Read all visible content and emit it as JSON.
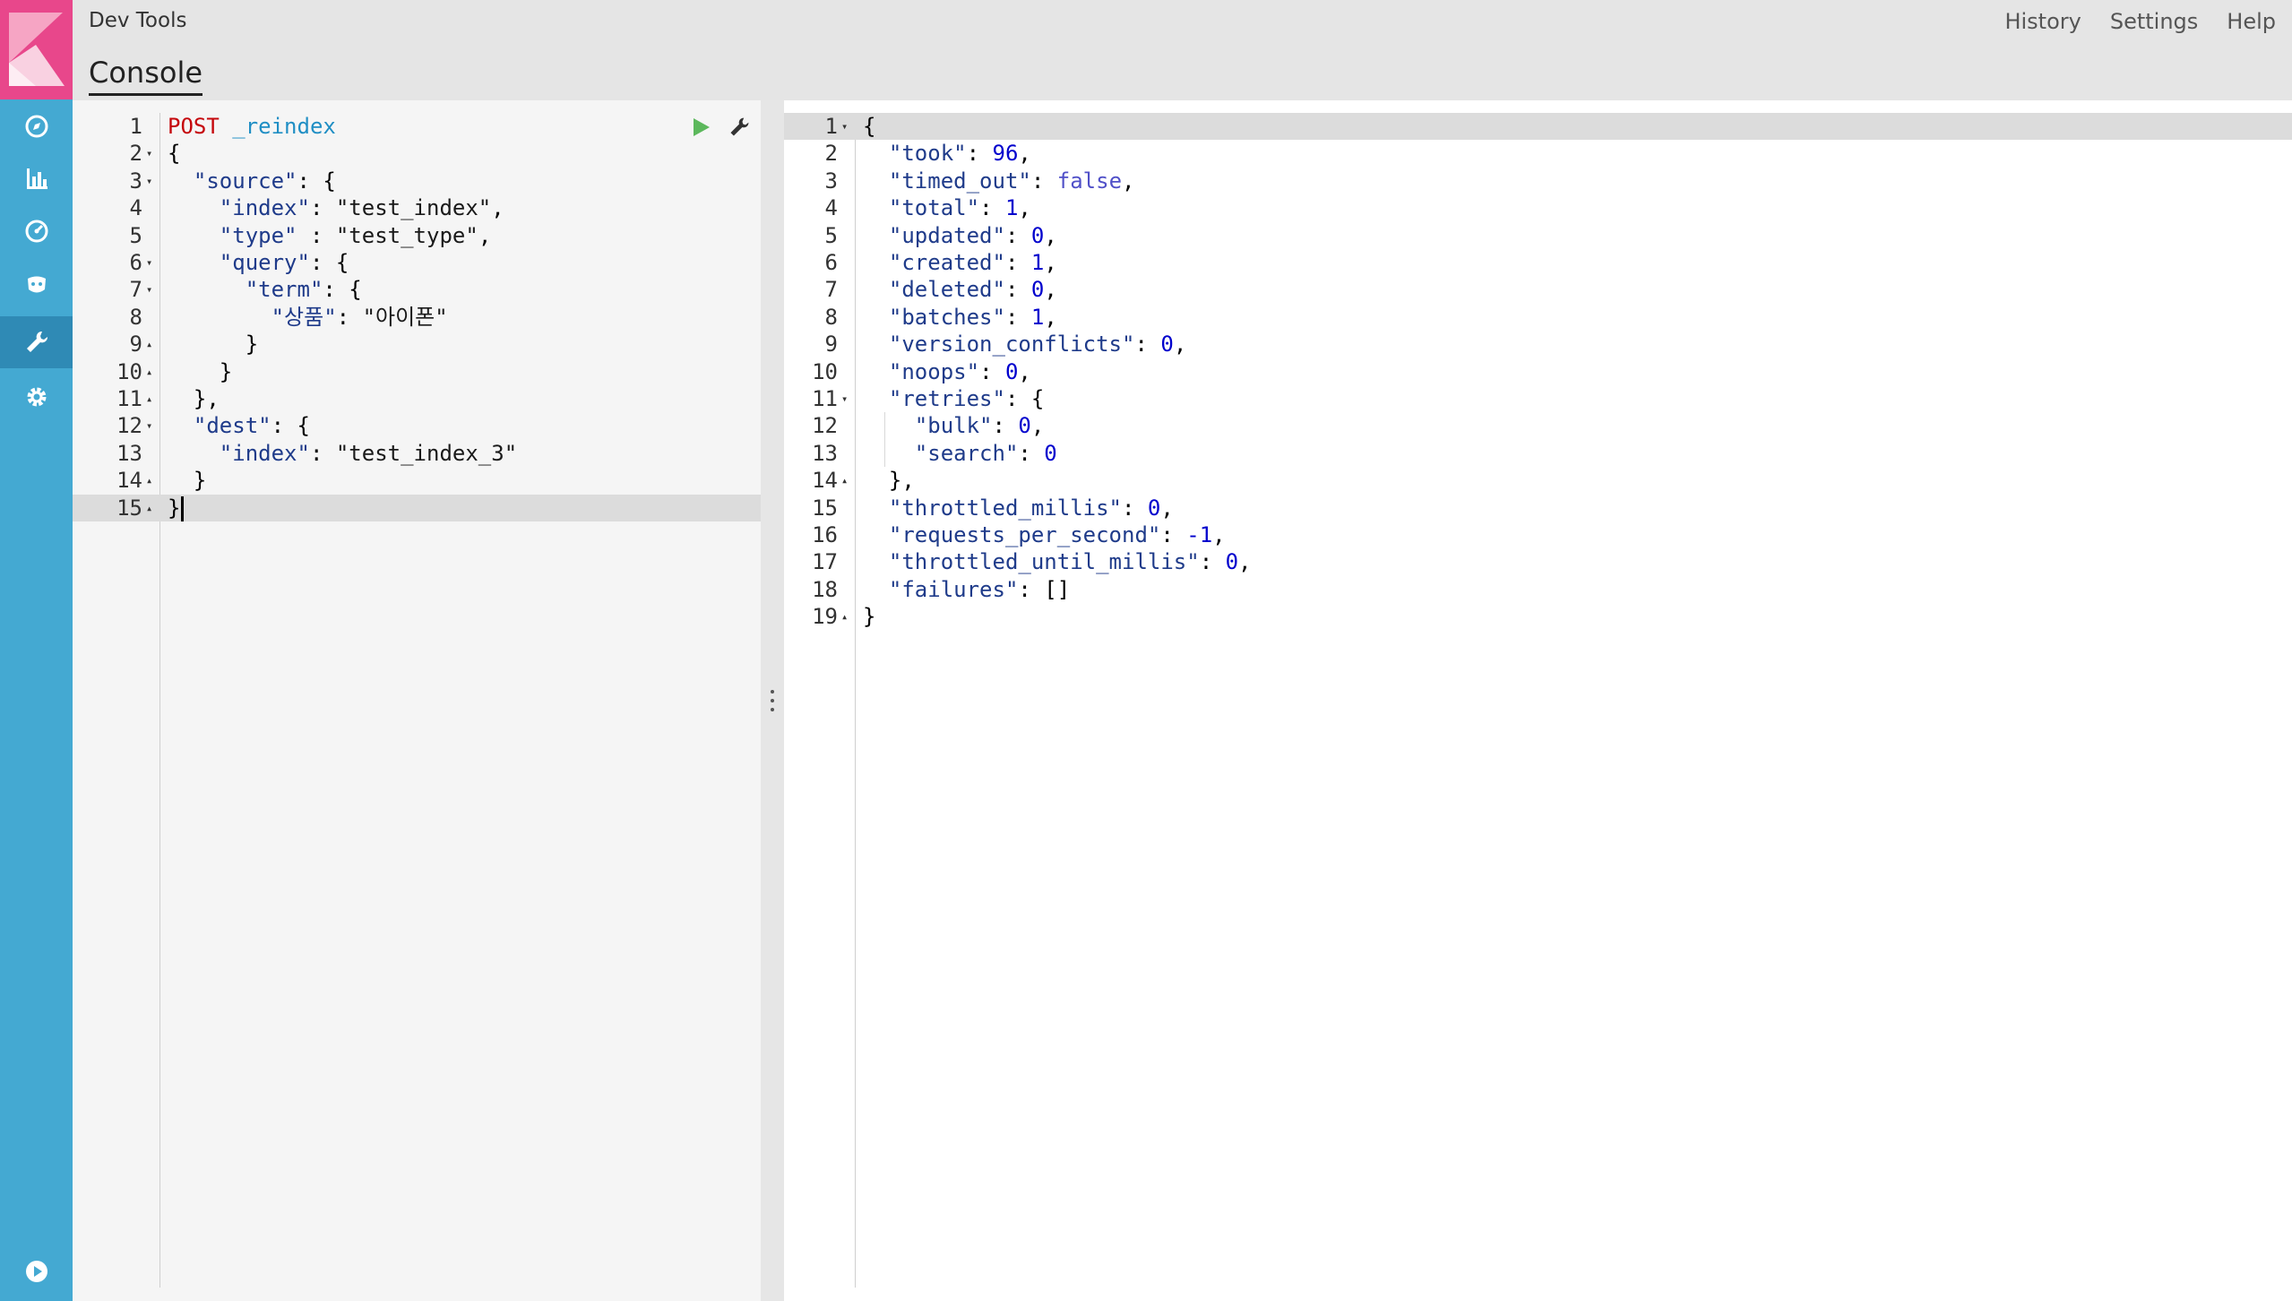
{
  "app": {
    "title": "Dev Tools",
    "tab": "Console"
  },
  "top_links": [
    "History",
    "Settings",
    "Help"
  ],
  "colors": {
    "sidebar": "#44a9d2",
    "logo": "#e8478b",
    "topbar": "#e5e5e5",
    "method": "#c5060b",
    "url": "#1f8ec4",
    "number": "#0000cd",
    "bool": "#5050c8",
    "run": "#5cb85c"
  },
  "sidebar": {
    "items": [
      {
        "name": "discover-icon"
      },
      {
        "name": "visualize-icon"
      },
      {
        "name": "dashboard-icon"
      },
      {
        "name": "timelion-icon"
      },
      {
        "name": "devtools-icon",
        "active": true
      },
      {
        "name": "management-icon"
      }
    ],
    "bottom": "collapse-icon"
  },
  "request": {
    "active_line": 15,
    "lines": [
      {
        "n": "1",
        "fold": "",
        "tokens": [
          [
            "method",
            "POST"
          ],
          [
            "punc",
            " "
          ],
          [
            "url",
            "_reindex"
          ]
        ]
      },
      {
        "n": "2",
        "fold": "▾",
        "tokens": [
          [
            "punc",
            "{"
          ]
        ]
      },
      {
        "n": "3",
        "fold": "▾",
        "tokens": [
          [
            "punc",
            "  "
          ],
          [
            "key",
            "\"source\""
          ],
          [
            "punc",
            ": {"
          ]
        ]
      },
      {
        "n": "4",
        "fold": "",
        "tokens": [
          [
            "punc",
            "    "
          ],
          [
            "key",
            "\"index\""
          ],
          [
            "punc",
            ": "
          ],
          [
            "str",
            "\"test_index\""
          ],
          [
            "punc",
            ","
          ]
        ]
      },
      {
        "n": "5",
        "fold": "",
        "tokens": [
          [
            "punc",
            "    "
          ],
          [
            "key",
            "\"type\""
          ],
          [
            "punc",
            " : "
          ],
          [
            "str",
            "\"test_type\""
          ],
          [
            "punc",
            ","
          ]
        ]
      },
      {
        "n": "6",
        "fold": "▾",
        "tokens": [
          [
            "punc",
            "    "
          ],
          [
            "key",
            "\"query\""
          ],
          [
            "punc",
            ": {"
          ]
        ]
      },
      {
        "n": "7",
        "fold": "▾",
        "tokens": [
          [
            "punc",
            "      "
          ],
          [
            "key",
            "\"term\""
          ],
          [
            "punc",
            ": {"
          ]
        ]
      },
      {
        "n": "8",
        "fold": "",
        "tokens": [
          [
            "punc",
            "        "
          ],
          [
            "key",
            "\"상품\""
          ],
          [
            "punc",
            ": "
          ],
          [
            "str",
            "\"아이폰\""
          ]
        ]
      },
      {
        "n": "9",
        "fold": "▴",
        "tokens": [
          [
            "punc",
            "      }"
          ]
        ]
      },
      {
        "n": "10",
        "fold": "▴",
        "tokens": [
          [
            "punc",
            "    }"
          ]
        ]
      },
      {
        "n": "11",
        "fold": "▴",
        "tokens": [
          [
            "punc",
            "  },"
          ]
        ]
      },
      {
        "n": "12",
        "fold": "▾",
        "tokens": [
          [
            "punc",
            "  "
          ],
          [
            "key",
            "\"dest\""
          ],
          [
            "punc",
            ": {"
          ]
        ]
      },
      {
        "n": "13",
        "fold": "",
        "tokens": [
          [
            "punc",
            "    "
          ],
          [
            "key",
            "\"index\""
          ],
          [
            "punc",
            ": "
          ],
          [
            "str",
            "\"test_index_3\""
          ]
        ]
      },
      {
        "n": "14",
        "fold": "▴",
        "tokens": [
          [
            "punc",
            "  }"
          ]
        ]
      },
      {
        "n": "15",
        "fold": "▴",
        "tokens": [
          [
            "punc",
            "}"
          ]
        ]
      }
    ]
  },
  "response": {
    "active_line": 1,
    "lines": [
      {
        "n": "1",
        "fold": "▾",
        "tokens": [
          [
            "punc",
            "{"
          ]
        ]
      },
      {
        "n": "2",
        "fold": "",
        "tokens": [
          [
            "punc",
            "  "
          ],
          [
            "key",
            "\"took\""
          ],
          [
            "punc",
            ": "
          ],
          [
            "num",
            "96"
          ],
          [
            "punc",
            ","
          ]
        ]
      },
      {
        "n": "3",
        "fold": "",
        "tokens": [
          [
            "punc",
            "  "
          ],
          [
            "key",
            "\"timed_out\""
          ],
          [
            "punc",
            ": "
          ],
          [
            "bool",
            "false"
          ],
          [
            "punc",
            ","
          ]
        ]
      },
      {
        "n": "4",
        "fold": "",
        "tokens": [
          [
            "punc",
            "  "
          ],
          [
            "key",
            "\"total\""
          ],
          [
            "punc",
            ": "
          ],
          [
            "num",
            "1"
          ],
          [
            "punc",
            ","
          ]
        ]
      },
      {
        "n": "5",
        "fold": "",
        "tokens": [
          [
            "punc",
            "  "
          ],
          [
            "key",
            "\"updated\""
          ],
          [
            "punc",
            ": "
          ],
          [
            "num",
            "0"
          ],
          [
            "punc",
            ","
          ]
        ]
      },
      {
        "n": "6",
        "fold": "",
        "tokens": [
          [
            "punc",
            "  "
          ],
          [
            "key",
            "\"created\""
          ],
          [
            "punc",
            ": "
          ],
          [
            "num",
            "1"
          ],
          [
            "punc",
            ","
          ]
        ]
      },
      {
        "n": "7",
        "fold": "",
        "tokens": [
          [
            "punc",
            "  "
          ],
          [
            "key",
            "\"deleted\""
          ],
          [
            "punc",
            ": "
          ],
          [
            "num",
            "0"
          ],
          [
            "punc",
            ","
          ]
        ]
      },
      {
        "n": "8",
        "fold": "",
        "tokens": [
          [
            "punc",
            "  "
          ],
          [
            "key",
            "\"batches\""
          ],
          [
            "punc",
            ": "
          ],
          [
            "num",
            "1"
          ],
          [
            "punc",
            ","
          ]
        ]
      },
      {
        "n": "9",
        "fold": "",
        "tokens": [
          [
            "punc",
            "  "
          ],
          [
            "key",
            "\"version_conflicts\""
          ],
          [
            "punc",
            ": "
          ],
          [
            "num",
            "0"
          ],
          [
            "punc",
            ","
          ]
        ]
      },
      {
        "n": "10",
        "fold": "",
        "tokens": [
          [
            "punc",
            "  "
          ],
          [
            "key",
            "\"noops\""
          ],
          [
            "punc",
            ": "
          ],
          [
            "num",
            "0"
          ],
          [
            "punc",
            ","
          ]
        ]
      },
      {
        "n": "11",
        "fold": "▾",
        "tokens": [
          [
            "punc",
            "  "
          ],
          [
            "key",
            "\"retries\""
          ],
          [
            "punc",
            ": {"
          ]
        ]
      },
      {
        "n": "12",
        "fold": "",
        "tokens": [
          [
            "punc",
            "    "
          ],
          [
            "key",
            "\"bulk\""
          ],
          [
            "punc",
            ": "
          ],
          [
            "num",
            "0"
          ],
          [
            "punc",
            ","
          ]
        ]
      },
      {
        "n": "13",
        "fold": "",
        "tokens": [
          [
            "punc",
            "    "
          ],
          [
            "key",
            "\"search\""
          ],
          [
            "punc",
            ": "
          ],
          [
            "num",
            "0"
          ]
        ]
      },
      {
        "n": "14",
        "fold": "▴",
        "tokens": [
          [
            "punc",
            "  },"
          ]
        ]
      },
      {
        "n": "15",
        "fold": "",
        "tokens": [
          [
            "punc",
            "  "
          ],
          [
            "key",
            "\"throttled_millis\""
          ],
          [
            "punc",
            ": "
          ],
          [
            "num",
            "0"
          ],
          [
            "punc",
            ","
          ]
        ]
      },
      {
        "n": "16",
        "fold": "",
        "tokens": [
          [
            "punc",
            "  "
          ],
          [
            "key",
            "\"requests_per_second\""
          ],
          [
            "punc",
            ": "
          ],
          [
            "num",
            "-1"
          ],
          [
            "punc",
            ","
          ]
        ]
      },
      {
        "n": "17",
        "fold": "",
        "tokens": [
          [
            "punc",
            "  "
          ],
          [
            "key",
            "\"throttled_until_millis\""
          ],
          [
            "punc",
            ": "
          ],
          [
            "num",
            "0"
          ],
          [
            "punc",
            ","
          ]
        ]
      },
      {
        "n": "18",
        "fold": "",
        "tokens": [
          [
            "punc",
            "  "
          ],
          [
            "key",
            "\"failures\""
          ],
          [
            "punc",
            ": []"
          ]
        ]
      },
      {
        "n": "19",
        "fold": "▴",
        "tokens": [
          [
            "punc",
            "}"
          ]
        ]
      }
    ]
  }
}
